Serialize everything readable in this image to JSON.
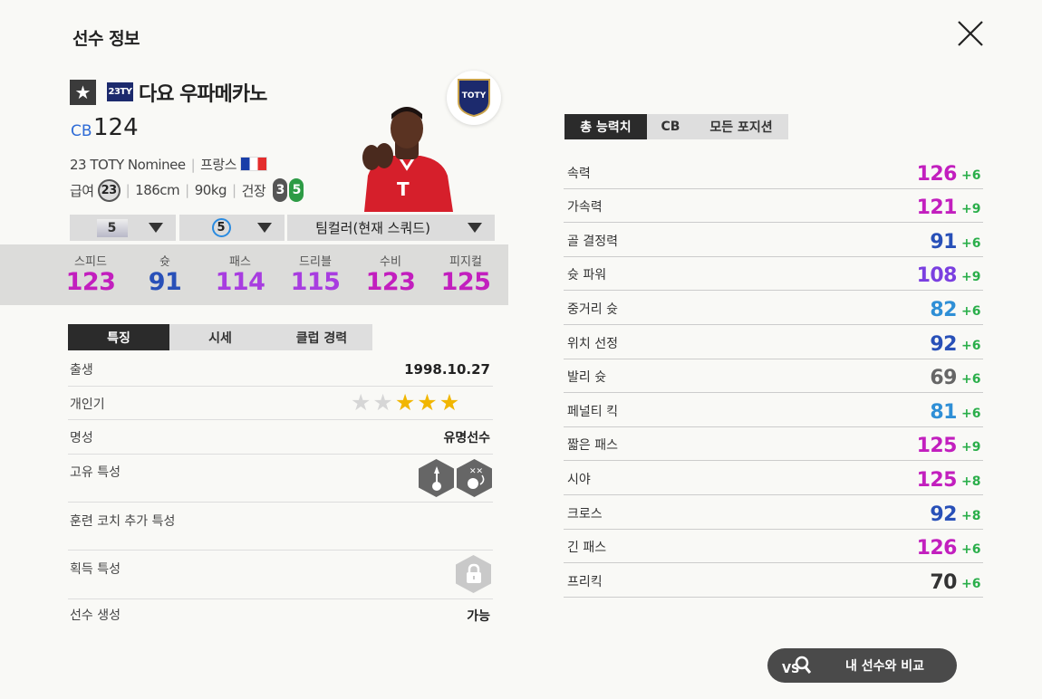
{
  "header": {
    "title": "선수 정보"
  },
  "player": {
    "star_badge": "★",
    "season_badge": "23TY",
    "name": "다요 우파메카노",
    "position": "CB",
    "ovr": "124",
    "season_name": "23 TOTY Nominee",
    "nation": "프랑스",
    "pay_label": "급여",
    "pay": "23",
    "height": "186cm",
    "weight": "90kg",
    "body": "건장",
    "weak_foot_left": "3",
    "weak_foot_right": "5",
    "season_logo_text": "TOTY"
  },
  "dropdowns": {
    "upgrade_level": "5",
    "skill_level": "5",
    "team_color": "팀컬러(현재 스쿼드)"
  },
  "stats": [
    {
      "label": "스피드",
      "value": "123",
      "color": "#c21fbe"
    },
    {
      "label": "슛",
      "value": "91",
      "color": "#2850b8"
    },
    {
      "label": "패스",
      "value": "114",
      "color": "#a83de0"
    },
    {
      "label": "드리블",
      "value": "115",
      "color": "#a83de0"
    },
    {
      "label": "수비",
      "value": "123",
      "color": "#c21fbe"
    },
    {
      "label": "피지컬",
      "value": "125",
      "color": "#c21fbe"
    }
  ],
  "left_tabs": [
    "특징",
    "시세",
    "클럽 경력"
  ],
  "info": {
    "birth_label": "출생",
    "birth": "1998.10.27",
    "popularity_label": "개인기",
    "popularity_stars": 5,
    "popularity_filled": 3,
    "reputation_label": "명성",
    "reputation": "유명선수",
    "traits_label": "고유 특성",
    "coach_traits_label": "훈련 코치 추가 특성",
    "acquired_traits_label": "획득 특성",
    "creation_label": "선수 생성",
    "creation": "가능"
  },
  "right_tabs": [
    "총 능력치",
    "CB",
    "모든 포지션"
  ],
  "attributes": [
    {
      "name": "속력",
      "value": "126",
      "bonus": "+6",
      "color": "#c21fbe"
    },
    {
      "name": "가속력",
      "value": "121",
      "bonus": "+9",
      "color": "#c21fbe"
    },
    {
      "name": "골 결정력",
      "value": "91",
      "bonus": "+6",
      "color": "#2850b8"
    },
    {
      "name": "슛 파워",
      "value": "108",
      "bonus": "+9",
      "color": "#7a3fe0"
    },
    {
      "name": "중거리 슛",
      "value": "82",
      "bonus": "+6",
      "color": "#2f8fd6"
    },
    {
      "name": "위치 선정",
      "value": "92",
      "bonus": "+6",
      "color": "#2850b8"
    },
    {
      "name": "발리 슛",
      "value": "69",
      "bonus": "+6",
      "color": "#666666"
    },
    {
      "name": "페널티 킥",
      "value": "81",
      "bonus": "+6",
      "color": "#2f8fd6"
    },
    {
      "name": "짧은 패스",
      "value": "125",
      "bonus": "+9",
      "color": "#c21fbe"
    },
    {
      "name": "시야",
      "value": "125",
      "bonus": "+8",
      "color": "#c21fbe"
    },
    {
      "name": "크로스",
      "value": "92",
      "bonus": "+8",
      "color": "#2850b8"
    },
    {
      "name": "긴 패스",
      "value": "126",
      "bonus": "+6",
      "color": "#c21fbe"
    },
    {
      "name": "프리킥",
      "value": "70",
      "bonus": "+6",
      "color": "#333333"
    }
  ],
  "compare_button": {
    "icon_text": "VS",
    "label": "내 선수와 비교"
  }
}
